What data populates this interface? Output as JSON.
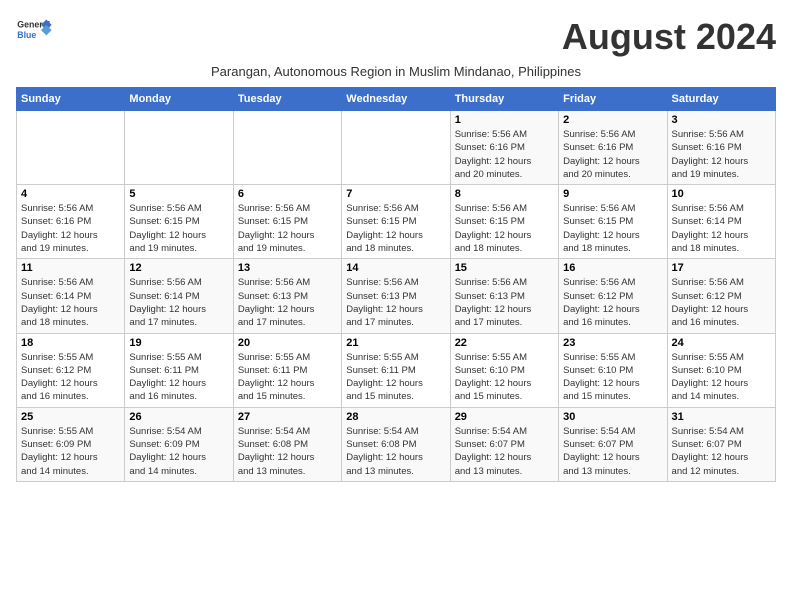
{
  "logo": {
    "line1": "General",
    "line2": "Blue"
  },
  "title": "August 2024",
  "subtitle": "Parangan, Autonomous Region in Muslim Mindanao, Philippines",
  "days_of_week": [
    "Sunday",
    "Monday",
    "Tuesday",
    "Wednesday",
    "Thursday",
    "Friday",
    "Saturday"
  ],
  "weeks": [
    [
      {
        "day": "",
        "info": ""
      },
      {
        "day": "",
        "info": ""
      },
      {
        "day": "",
        "info": ""
      },
      {
        "day": "",
        "info": ""
      },
      {
        "day": "1",
        "info": "Sunrise: 5:56 AM\nSunset: 6:16 PM\nDaylight: 12 hours\nand 20 minutes."
      },
      {
        "day": "2",
        "info": "Sunrise: 5:56 AM\nSunset: 6:16 PM\nDaylight: 12 hours\nand 20 minutes."
      },
      {
        "day": "3",
        "info": "Sunrise: 5:56 AM\nSunset: 6:16 PM\nDaylight: 12 hours\nand 19 minutes."
      }
    ],
    [
      {
        "day": "4",
        "info": "Sunrise: 5:56 AM\nSunset: 6:16 PM\nDaylight: 12 hours\nand 19 minutes."
      },
      {
        "day": "5",
        "info": "Sunrise: 5:56 AM\nSunset: 6:15 PM\nDaylight: 12 hours\nand 19 minutes."
      },
      {
        "day": "6",
        "info": "Sunrise: 5:56 AM\nSunset: 6:15 PM\nDaylight: 12 hours\nand 19 minutes."
      },
      {
        "day": "7",
        "info": "Sunrise: 5:56 AM\nSunset: 6:15 PM\nDaylight: 12 hours\nand 18 minutes."
      },
      {
        "day": "8",
        "info": "Sunrise: 5:56 AM\nSunset: 6:15 PM\nDaylight: 12 hours\nand 18 minutes."
      },
      {
        "day": "9",
        "info": "Sunrise: 5:56 AM\nSunset: 6:15 PM\nDaylight: 12 hours\nand 18 minutes."
      },
      {
        "day": "10",
        "info": "Sunrise: 5:56 AM\nSunset: 6:14 PM\nDaylight: 12 hours\nand 18 minutes."
      }
    ],
    [
      {
        "day": "11",
        "info": "Sunrise: 5:56 AM\nSunset: 6:14 PM\nDaylight: 12 hours\nand 18 minutes."
      },
      {
        "day": "12",
        "info": "Sunrise: 5:56 AM\nSunset: 6:14 PM\nDaylight: 12 hours\nand 17 minutes."
      },
      {
        "day": "13",
        "info": "Sunrise: 5:56 AM\nSunset: 6:13 PM\nDaylight: 12 hours\nand 17 minutes."
      },
      {
        "day": "14",
        "info": "Sunrise: 5:56 AM\nSunset: 6:13 PM\nDaylight: 12 hours\nand 17 minutes."
      },
      {
        "day": "15",
        "info": "Sunrise: 5:56 AM\nSunset: 6:13 PM\nDaylight: 12 hours\nand 17 minutes."
      },
      {
        "day": "16",
        "info": "Sunrise: 5:56 AM\nSunset: 6:12 PM\nDaylight: 12 hours\nand 16 minutes."
      },
      {
        "day": "17",
        "info": "Sunrise: 5:56 AM\nSunset: 6:12 PM\nDaylight: 12 hours\nand 16 minutes."
      }
    ],
    [
      {
        "day": "18",
        "info": "Sunrise: 5:55 AM\nSunset: 6:12 PM\nDaylight: 12 hours\nand 16 minutes."
      },
      {
        "day": "19",
        "info": "Sunrise: 5:55 AM\nSunset: 6:11 PM\nDaylight: 12 hours\nand 16 minutes."
      },
      {
        "day": "20",
        "info": "Sunrise: 5:55 AM\nSunset: 6:11 PM\nDaylight: 12 hours\nand 15 minutes."
      },
      {
        "day": "21",
        "info": "Sunrise: 5:55 AM\nSunset: 6:11 PM\nDaylight: 12 hours\nand 15 minutes."
      },
      {
        "day": "22",
        "info": "Sunrise: 5:55 AM\nSunset: 6:10 PM\nDaylight: 12 hours\nand 15 minutes."
      },
      {
        "day": "23",
        "info": "Sunrise: 5:55 AM\nSunset: 6:10 PM\nDaylight: 12 hours\nand 15 minutes."
      },
      {
        "day": "24",
        "info": "Sunrise: 5:55 AM\nSunset: 6:10 PM\nDaylight: 12 hours\nand 14 minutes."
      }
    ],
    [
      {
        "day": "25",
        "info": "Sunrise: 5:55 AM\nSunset: 6:09 PM\nDaylight: 12 hours\nand 14 minutes."
      },
      {
        "day": "26",
        "info": "Sunrise: 5:54 AM\nSunset: 6:09 PM\nDaylight: 12 hours\nand 14 minutes."
      },
      {
        "day": "27",
        "info": "Sunrise: 5:54 AM\nSunset: 6:08 PM\nDaylight: 12 hours\nand 13 minutes."
      },
      {
        "day": "28",
        "info": "Sunrise: 5:54 AM\nSunset: 6:08 PM\nDaylight: 12 hours\nand 13 minutes."
      },
      {
        "day": "29",
        "info": "Sunrise: 5:54 AM\nSunset: 6:07 PM\nDaylight: 12 hours\nand 13 minutes."
      },
      {
        "day": "30",
        "info": "Sunrise: 5:54 AM\nSunset: 6:07 PM\nDaylight: 12 hours\nand 13 minutes."
      },
      {
        "day": "31",
        "info": "Sunrise: 5:54 AM\nSunset: 6:07 PM\nDaylight: 12 hours\nand 12 minutes."
      }
    ]
  ]
}
